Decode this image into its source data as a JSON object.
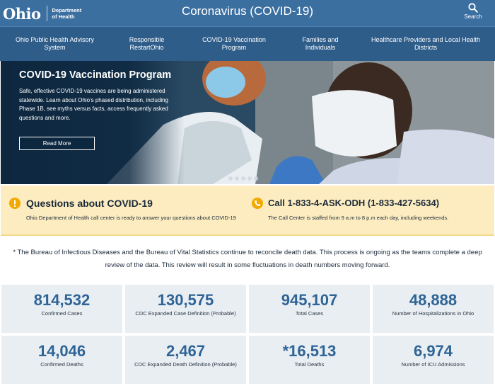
{
  "header": {
    "logo_word": "Ohio",
    "dept_line1": "Department",
    "dept_line2": "of Health",
    "site_title": "Coronavirus (COVID-19)",
    "search_label": "Search"
  },
  "nav": {
    "items": [
      {
        "line1": "Ohio Public Health Advisory",
        "line2": "System"
      },
      {
        "line1": "Responsible",
        "line2": "RestartOhio"
      },
      {
        "line1": "COVID-19 Vaccination",
        "line2": "Program"
      },
      {
        "line1": "Families and",
        "line2": "Individuals"
      },
      {
        "line1": "Healthcare Providers and Local Health",
        "line2": "Districts"
      }
    ]
  },
  "hero": {
    "title": "COVID-19 Vaccination Program",
    "text": "Safe, effective COVID-19 vaccines are being administered statewide. Learn about Ohio's phased distribution, including Phase 1B, see myths versus facts, access frequently asked questions and more.",
    "button_label": "Read More",
    "slide_count": 5
  },
  "callout": {
    "questions_title": "Questions about COVID-19",
    "questions_text": "Ohio Department of Health call center is ready to answer your questions about COVID-19",
    "call_title": "Call 1-833-4-ASK-ODH (1-833-427-5634)",
    "call_text": "The Call Center is staffed from 9 a.m to 8 p.m each day, including weekends.",
    "icon_color": "#f2a900",
    "background_color": "#fcecbf"
  },
  "note": {
    "text": "* The Bureau of Infectious Diseases and the Bureau of Vital Statistics continue to reconcile death data. This process is ongoing as the teams complete a deep review of the data. This review will result in some fluctuations in death numbers moving forward."
  },
  "stats": [
    {
      "value": "814,532",
      "label": "Confirmed Cases"
    },
    {
      "value": "130,575",
      "label": "CDC Expanded Case Definition (Probable)"
    },
    {
      "value": "945,107",
      "label": "Total Cases"
    },
    {
      "value": "48,888",
      "label": "Number of Hospitalizations in Ohio"
    },
    {
      "value": "14,046",
      "label": "Confirmed Deaths"
    },
    {
      "value": "2,467",
      "label": "CDC Expanded Death Definition (Probable)"
    },
    {
      "value": "*16,513",
      "label": "Total Deaths"
    },
    {
      "value": "6,974",
      "label": "Number of ICU Admissions"
    }
  ],
  "colors": {
    "header": "#3b6fa0",
    "nav": "#2f5d8a",
    "stat_value": "#2e6496",
    "stat_bg": "#e9eef3"
  }
}
